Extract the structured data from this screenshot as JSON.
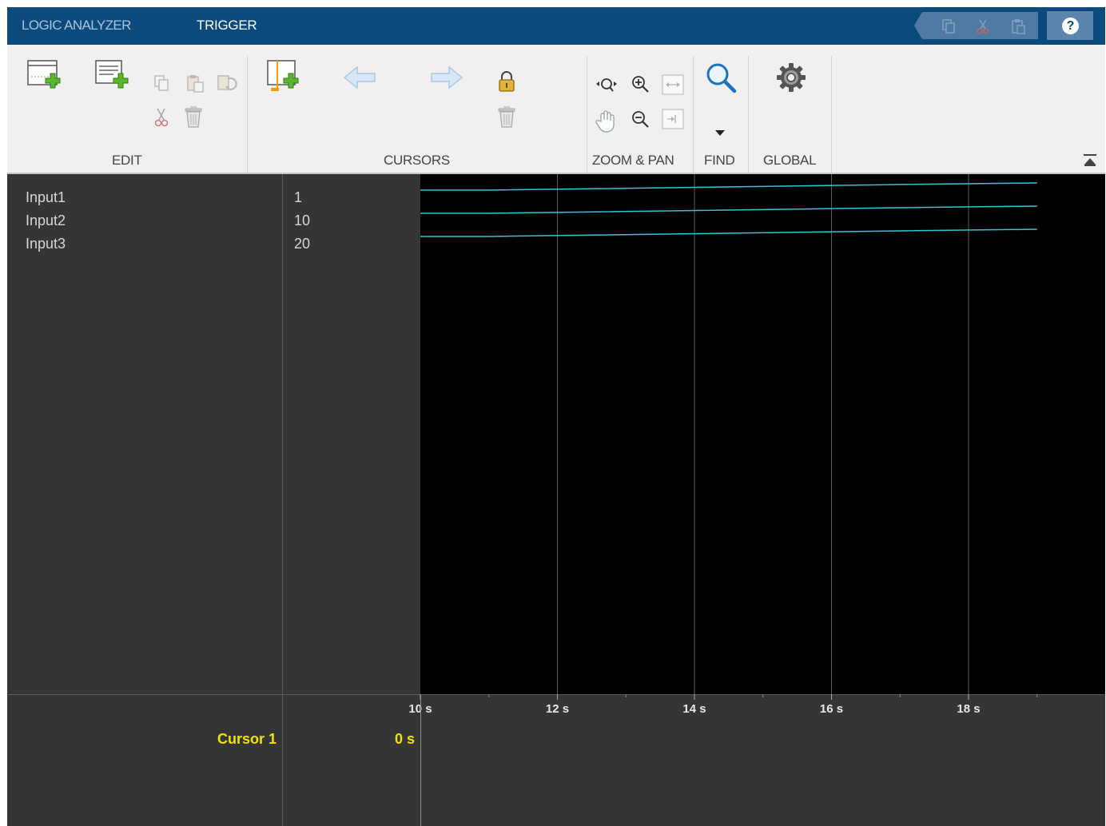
{
  "tabs": {
    "logic_analyzer": "LOGIC ANALYZER",
    "trigger": "TRIGGER"
  },
  "toolstrip": {
    "sections": {
      "edit": "EDIT",
      "cursors": "CURSORS",
      "zoom_pan": "ZOOM & PAN",
      "find": "FIND",
      "global": "GLOBAL"
    }
  },
  "signals": [
    {
      "name": "Input1",
      "value": "1"
    },
    {
      "name": "Input2",
      "value": "10"
    },
    {
      "name": "Input3",
      "value": "20"
    }
  ],
  "time_axis": {
    "ticks": [
      "10 s",
      "12 s",
      "14 s",
      "16 s",
      "18 s"
    ]
  },
  "cursor": {
    "label": "Cursor 1",
    "value": "0 s"
  },
  "colors": {
    "accent_bar": "#0a4a7d",
    "waveform": "#2ec8d3",
    "cursor_text": "#f0e400",
    "plot_bg": "#000000"
  }
}
